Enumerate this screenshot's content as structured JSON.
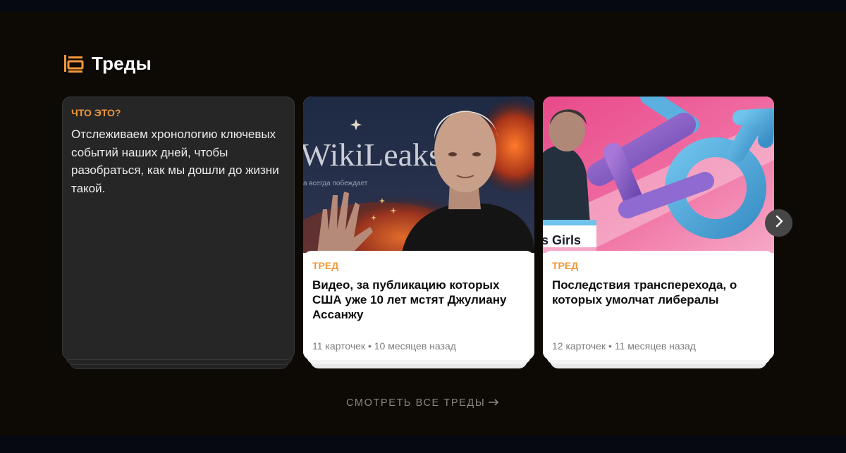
{
  "section": {
    "title": "Треды",
    "icon": "threads-stack-icon"
  },
  "info_card": {
    "kicker": "ЧТО ЭТО?",
    "text": "Отслеживаем хронологию ключевых событий наших дней, чтобы разобраться, как мы дошли до жизни такой."
  },
  "threads": [
    {
      "kicker": "ТРЕД",
      "title": "Видео, за публикацию которых США уже 10 лет мстят Джулиану Ассанжу",
      "meta": "11 карточек • 10 месяцев назад",
      "image_text": "WikiLeaks",
      "image_caption": "а всегда побеждает"
    },
    {
      "kicker": "ТРЕД",
      "title": "Последствия трансперехода, о которых умолчат либералы",
      "meta": "12 карточек • 11 месяцев назад",
      "image_text": "s Girls"
    }
  ],
  "next_button": {
    "icon": "chevron-right-icon"
  },
  "see_all": {
    "label": "СМОТРЕТЬ ВСЕ ТРЕДЫ",
    "icon": "arrow-right-icon"
  },
  "colors": {
    "accent": "#f0973a",
    "background": "#0d0905",
    "card_dark": "#262626"
  }
}
